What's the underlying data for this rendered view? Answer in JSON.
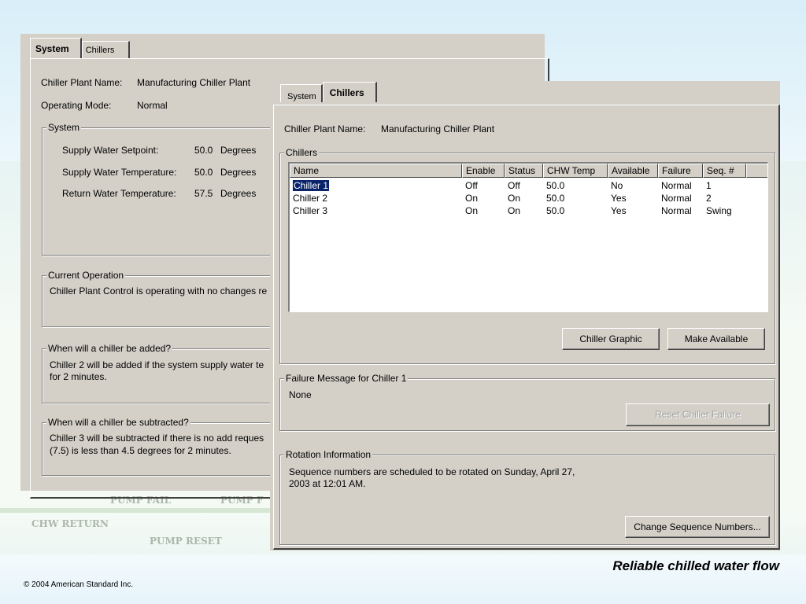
{
  "back_window": {
    "tabs": [
      {
        "label": "System",
        "active": true
      },
      {
        "label": "Chillers",
        "active": false
      }
    ],
    "plant_name_label": "Chiller Plant Name:",
    "plant_name_value": "Manufacturing Chiller Plant",
    "mode_label": "Operating Mode:",
    "mode_value": "Normal",
    "system_group": {
      "title": "System",
      "rows": [
        {
          "label": "Supply Water Setpoint:",
          "value": "50.0",
          "unit": "Degrees"
        },
        {
          "label": "Supply Water Temperature:",
          "value": "50.0",
          "unit": "Degrees"
        },
        {
          "label": "Return Water Temperature:",
          "value": "57.5",
          "unit": "Degrees"
        }
      ]
    },
    "current_operation": {
      "title": "Current Operation",
      "text": "Chiller Plant Control is operating with no changes re"
    },
    "added": {
      "title": "When will a chiller be added?",
      "line1": "Chiller 2 will be added if the system supply water te",
      "line2": "for 2 minutes."
    },
    "subtracted": {
      "title": "When will a chiller be subtracted?",
      "line1": "Chiller 3 will be subtracted if there is no add reques",
      "line2": "(7.5) is less than 4.5 degrees for 2 minutes."
    }
  },
  "front_window": {
    "tabs": [
      {
        "label": "System",
        "active": false
      },
      {
        "label": "Chillers",
        "active": true
      }
    ],
    "plant_name_label": "Chiller Plant Name:",
    "plant_name_value": "Manufacturing Chiller Plant",
    "chillers_group": {
      "title": "Chillers",
      "columns": [
        "Name",
        "Enable",
        "Status",
        "CHW Temp",
        "Available",
        "Failure",
        "Seq. #"
      ],
      "rows": [
        {
          "cells": [
            "Chiller 1",
            "Off",
            "Off",
            "50.0",
            "No",
            "Normal",
            "1"
          ],
          "selected": true
        },
        {
          "cells": [
            "Chiller 2",
            "On",
            "On",
            "50.0",
            "Yes",
            "Normal",
            "2"
          ],
          "selected": false
        },
        {
          "cells": [
            "Chiller 3",
            "On",
            "On",
            "50.0",
            "Yes",
            "Normal",
            "Swing"
          ],
          "selected": false
        }
      ],
      "chiller_graphic_button": "Chiller Graphic",
      "make_available_button": "Make Available"
    },
    "failure_group": {
      "title": "Failure Message for Chiller 1",
      "message": "None",
      "reset_button": "Reset Chiller Failure"
    },
    "rotation_group": {
      "title": "Rotation Information",
      "line1": "Sequence numbers are scheduled to be rotated on Sunday, April 27,",
      "line2": "2003 at 12:01 AM.",
      "change_button": "Change Sequence Numbers..."
    }
  },
  "background_labels": {
    "pump_fail": "PUMP FAIL",
    "pump_f": "PUMP F",
    "chw_return": "CHW RETURN",
    "pump_reset": "PUMP RESET"
  },
  "slide": {
    "copyright": "© 2004 American Standard Inc.",
    "caption": "Reliable chilled water flow"
  }
}
